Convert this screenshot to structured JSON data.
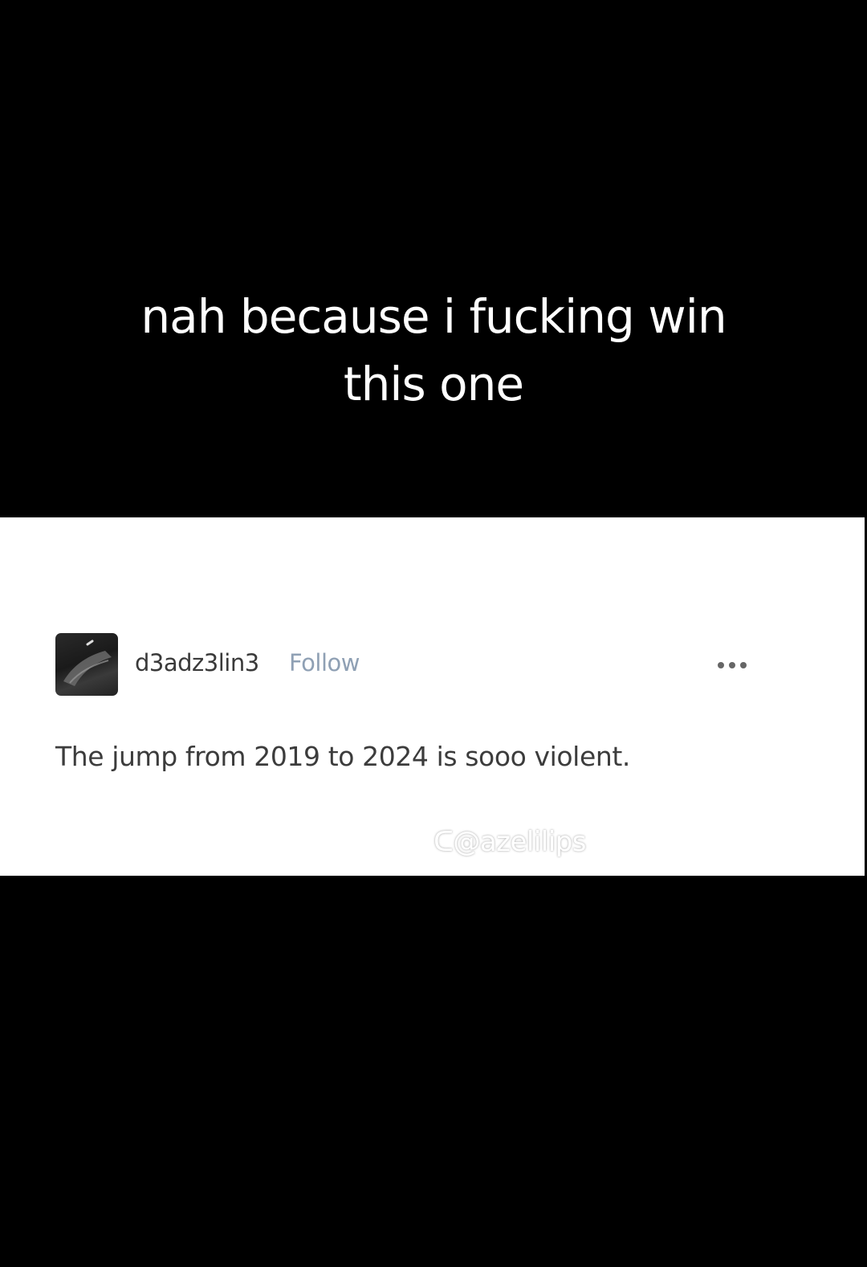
{
  "caption": {
    "line1": "nah because i fucking win",
    "line2": "this one"
  },
  "post": {
    "username": "d3adz3lin3",
    "follow_label": "Follow",
    "more_icon": "ellipsis-icon",
    "body": "The jump from 2019 to 2024 is sooo violent."
  },
  "watermark": {
    "text": "ᑕ@azelilips"
  },
  "colors": {
    "background": "#000000",
    "card": "#ffffff",
    "username": "#3a3a3a",
    "follow": "#8fa0b4",
    "body_text": "#3c3c3c"
  }
}
